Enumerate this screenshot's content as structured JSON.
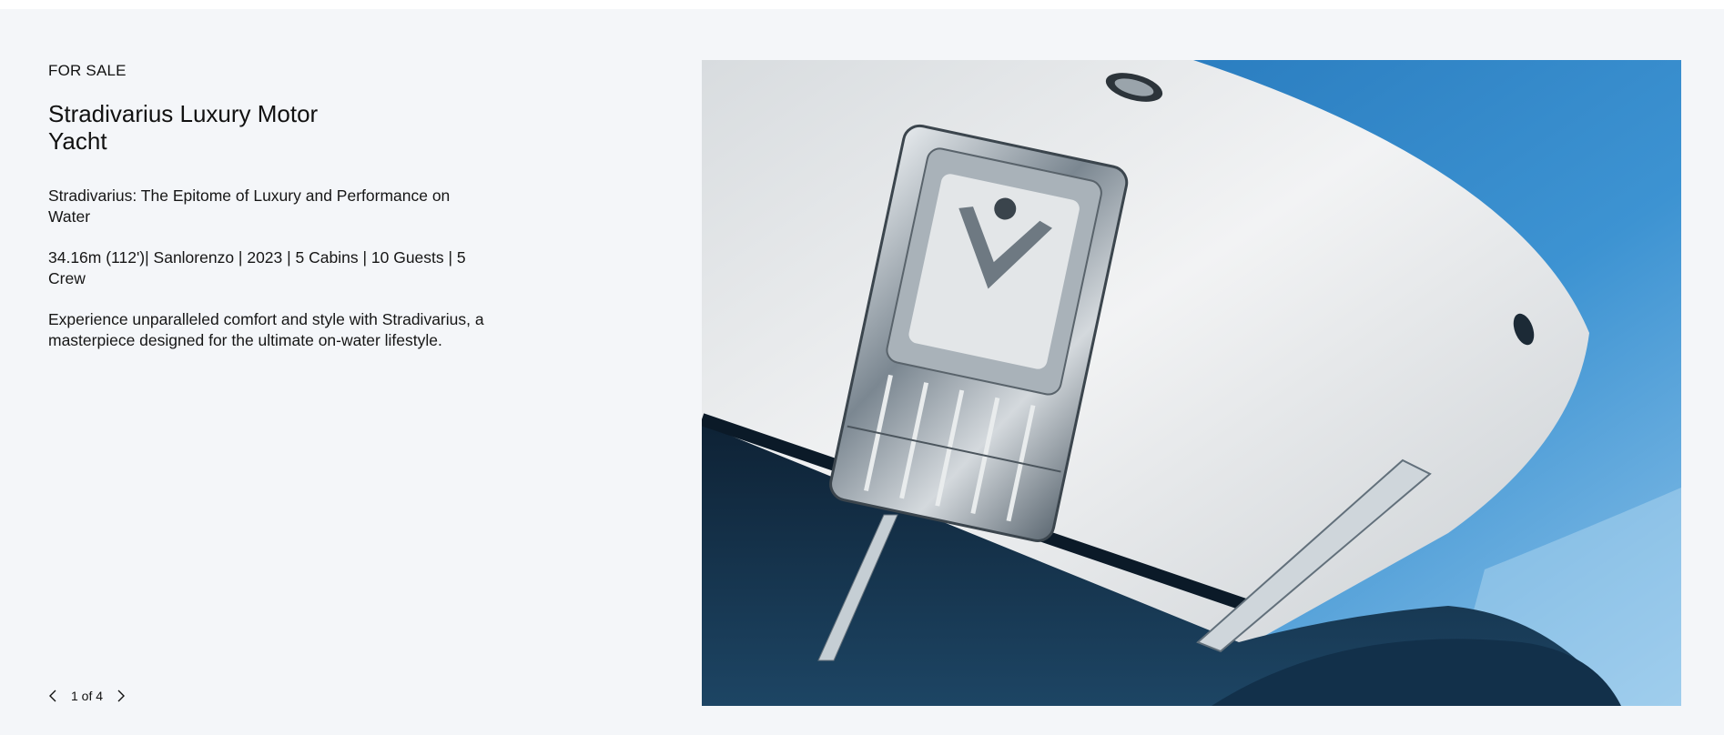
{
  "listing": {
    "eyebrow": "FOR SALE",
    "title": "Stradivarius Luxury Motor Yacht",
    "tagline": "Stradivarius: The Epitome of Luxury and Performance on Water",
    "specs": "34.16m (112')| Sanlorenzo | 2023 | 5 Cabins | 10 Guests | 5 Crew",
    "description": "Experience unparalleled comfort and style with Stradivarius, a masterpiece designed for the ultimate on-water lifestyle."
  },
  "pager": {
    "counter": "1 of 4",
    "prev_icon": "chevron-left-icon",
    "next_icon": "chevron-right-icon"
  },
  "photo": {
    "subject": "yacht-bow-anchor-photo",
    "colors": {
      "sky": "#2f86c8",
      "hull_white": "#e9ecee",
      "hull_dark": "#16324a",
      "steel": "#b9c2c9"
    }
  }
}
